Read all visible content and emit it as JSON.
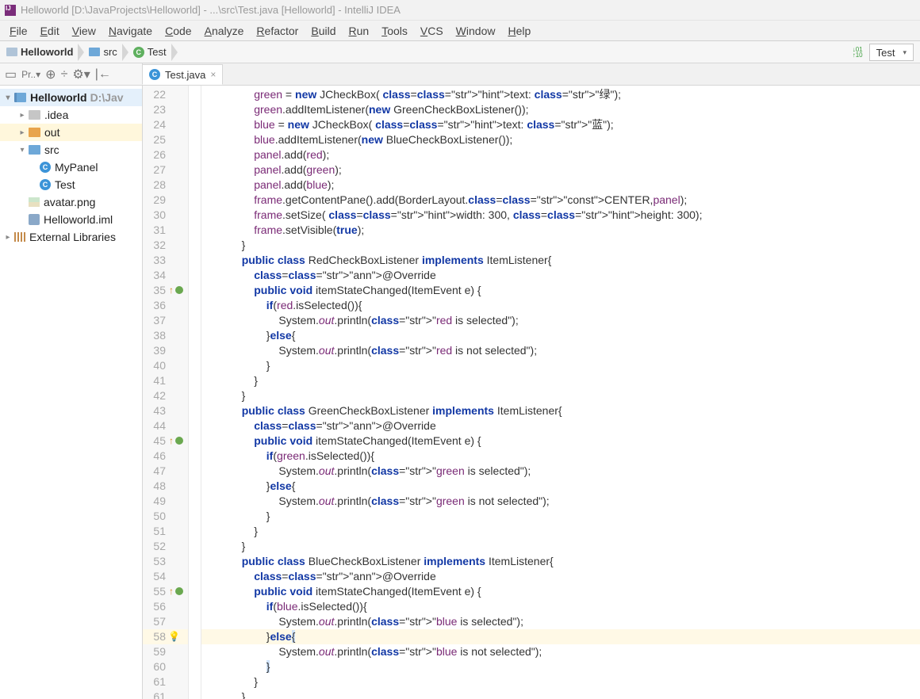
{
  "title": "Helloworld [D:\\JavaProjects\\Helloworld] - ...\\src\\Test.java [Helloworld] - IntelliJ IDEA",
  "menus": [
    "File",
    "Edit",
    "View",
    "Navigate",
    "Code",
    "Analyze",
    "Refactor",
    "Build",
    "Run",
    "Tools",
    "VCS",
    "Window",
    "Help"
  ],
  "breadcrumb": {
    "project": "Helloworld",
    "folder": "src",
    "class": "Test"
  },
  "run_config": "Test",
  "project_tree": {
    "root": {
      "name": "Helloworld",
      "path": "D:\\Jav"
    },
    "idea": ".idea",
    "out": "out",
    "src": "src",
    "mypanel": "MyPanel",
    "test": "Test",
    "avatar": "avatar.png",
    "iml": "Helloworld.iml",
    "ext": "External Libraries"
  },
  "tab": {
    "label": "Test.java"
  },
  "lines": {
    "start": 22,
    "raw": [
      "                green = new JCheckBox( ~text:~ \"绿\");",
      "                green.addItemListener(new GreenCheckBoxListener());",
      "                blue = new JCheckBox( ~text:~ \"蓝\");",
      "                blue.addItemListener(new BlueCheckBoxListener());",
      "                panel.add(red);",
      "                panel.add(green);",
      "                panel.add(blue);",
      "                frame.getContentPane().add(BorderLayout.CENTER,panel);",
      "                frame.setSize( ~width:~ 300, ~height:~ 300);",
      "                frame.setVisible(true);",
      "            }",
      "            public class RedCheckBoxListener implements ItemListener{",
      "                @Override",
      "                public void itemStateChanged(ItemEvent e) {",
      "                    if(red.isSelected()){",
      "                        System.out.println(\"red is selected\");",
      "                    }else{",
      "                        System.out.println(\"red is not selected\");",
      "                    }",
      "                }",
      "            }",
      "            public class GreenCheckBoxListener implements ItemListener{",
      "                @Override",
      "                public void itemStateChanged(ItemEvent e) {",
      "                    if(green.isSelected()){",
      "                        System.out.println(\"green is selected\");",
      "                    }else{",
      "                        System.out.println(\"green is not selected\");",
      "                    }",
      "                }",
      "            }",
      "            public class BlueCheckBoxListener implements ItemListener{",
      "                @Override",
      "                public void itemStateChanged(ItemEvent e) {",
      "                    if(blue.isSelected()){",
      "                        System.out.println(\"blue is selected\");",
      "                    }else{",
      "                        System.out.println(\"blue is not selected\");",
      "                    }",
      "                }"
    ],
    "caret_line": 58,
    "override_marks": [
      35,
      45,
      55
    ],
    "bulb_line": 58
  }
}
